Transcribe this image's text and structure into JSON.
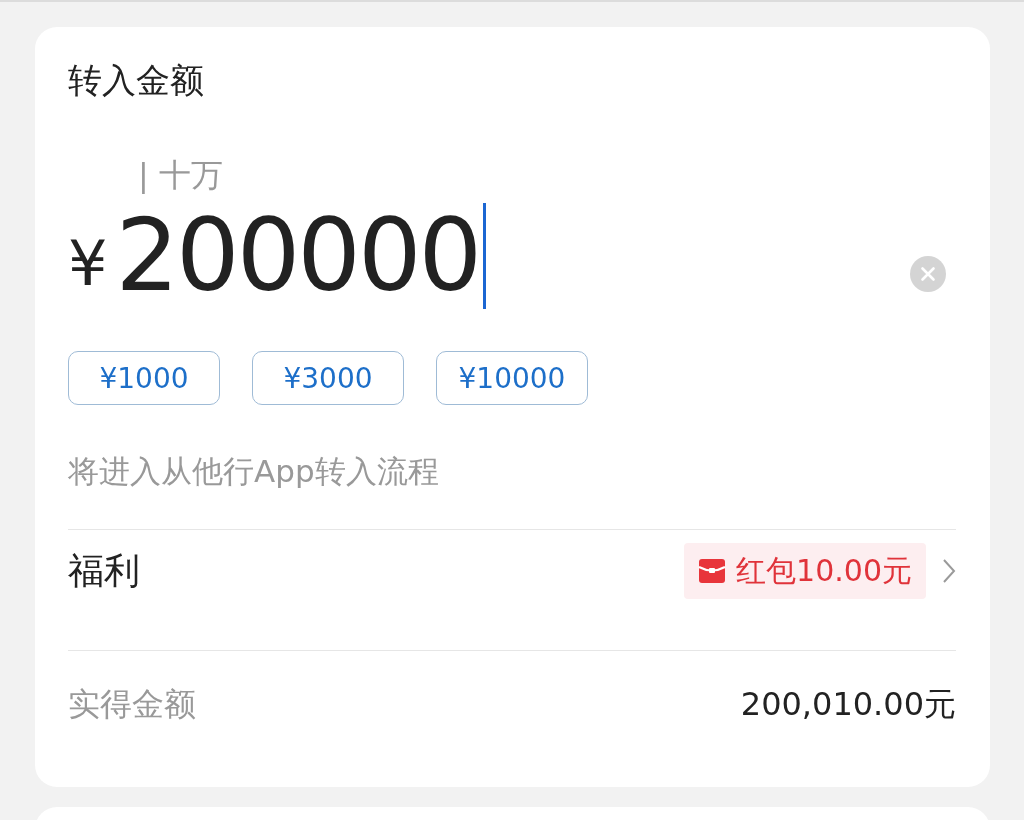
{
  "section_title": "转入金额",
  "amount": {
    "unit_hint": "| 十万",
    "currency": "¥",
    "value": "200000"
  },
  "quick_amounts": [
    "¥1000",
    "¥3000",
    "¥10000"
  ],
  "note": "将进入从他行App转入流程",
  "benefit": {
    "label": "福利",
    "badge": "红包10.00元"
  },
  "actual": {
    "label": "实得金额",
    "value": "200,010.00元"
  }
}
